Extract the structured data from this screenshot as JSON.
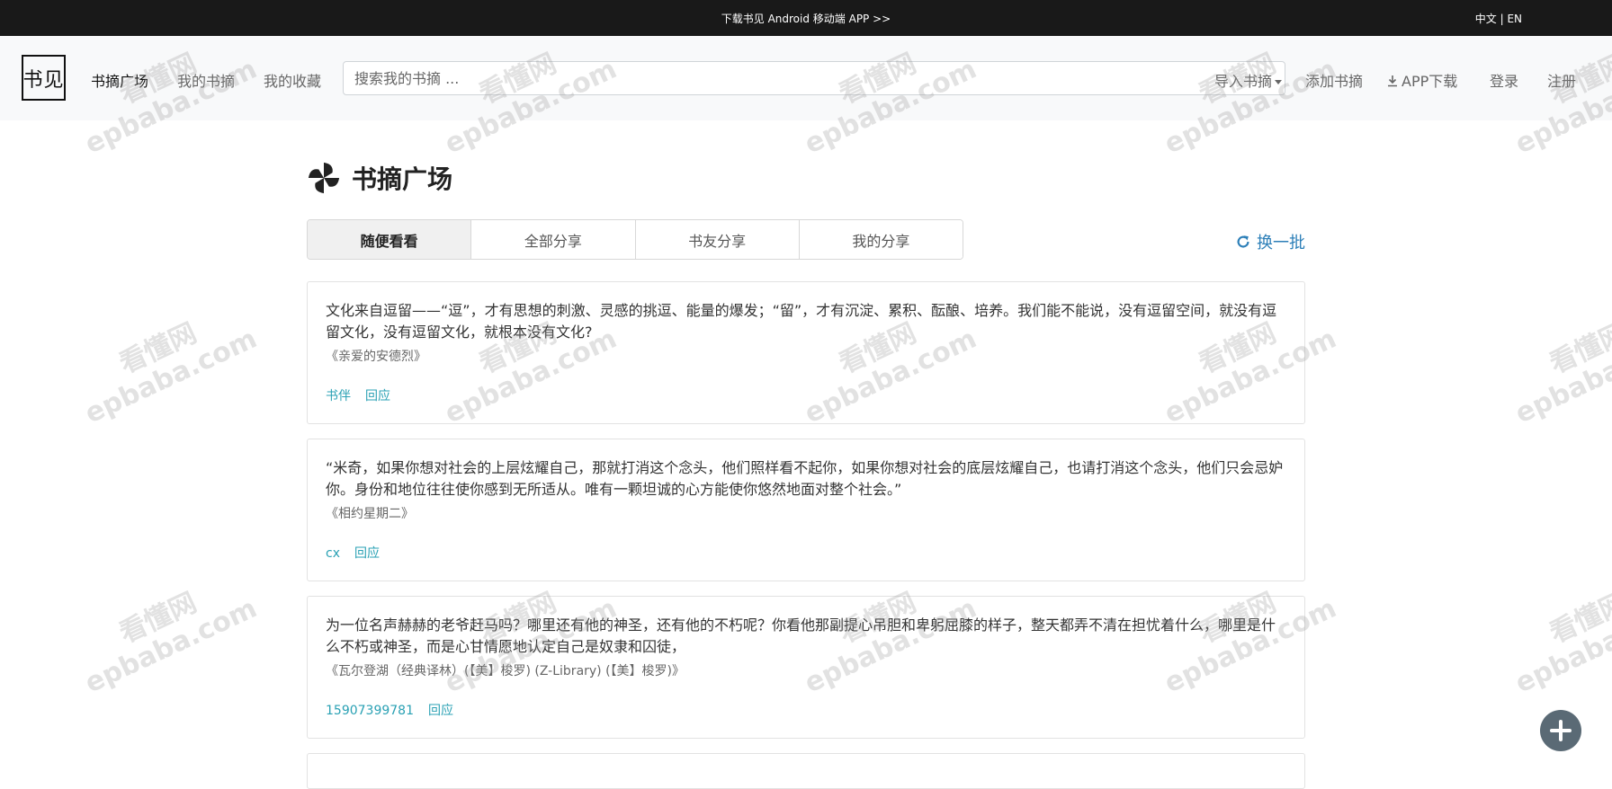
{
  "topbar": {
    "download_text": "下载书见 Android 移动端 APP >>",
    "lang": "中文 | EN"
  },
  "logo": {
    "left": "书",
    "right": "见"
  },
  "nav": {
    "items": [
      {
        "label": "书摘广场"
      },
      {
        "label": "我的书摘"
      },
      {
        "label": "我的收藏"
      }
    ],
    "search_placeholder": "搜索我的书摘 ...",
    "import_label": "导入书摘",
    "add_label": "添加书摘",
    "app_download_label": "APP下载",
    "login_label": "登录",
    "register_label": "注册"
  },
  "page": {
    "title": "书摘广场"
  },
  "tabs": [
    {
      "label": "随便看看"
    },
    {
      "label": "全部分享"
    },
    {
      "label": "书友分享"
    },
    {
      "label": "我的分享"
    }
  ],
  "refresh_label": "换一批",
  "cards": [
    {
      "quote": "文化来自逗留——“逗”，才有思想的刺激、灵感的挑逗、能量的爆发；“留”，才有沉淀、累积、酝酿、培养。我们能不能说，没有逗留空间，就没有逗留文化，没有逗留文化，就根本没有文化?",
      "source": "《亲爱的安德烈》",
      "user": "书伴",
      "reply": "回应"
    },
    {
      "quote": "“米奇，如果你想对社会的上层炫耀自己，那就打消这个念头，他们照样看不起你，如果你想对社会的底层炫耀自己，也请打消这个念头，他们只会忌妒你。身份和地位往往使你感到无所适从。唯有一颗坦诚的心方能使你悠然地面对整个社会。”",
      "source": "《相约星期二》",
      "user": "cx",
      "reply": "回应"
    },
    {
      "quote": "为一位名声赫赫的老爷赶马吗？哪里还有他的神圣，还有他的不朽呢？你看他那副提心吊胆和卑躬屈膝的样子，整天都弄不清在担忧着什么，哪里是什么不朽或神圣，而是心甘情愿地认定自己是奴隶和囚徒，",
      "source": "《瓦尔登湖（经典译林）(【美】梭罗) (Z-Library) (【美】梭罗)》",
      "user": "15907399781",
      "reply": "回应"
    }
  ],
  "watermark": {
    "line1": "看懂网",
    "line2": "epbaba.com"
  }
}
